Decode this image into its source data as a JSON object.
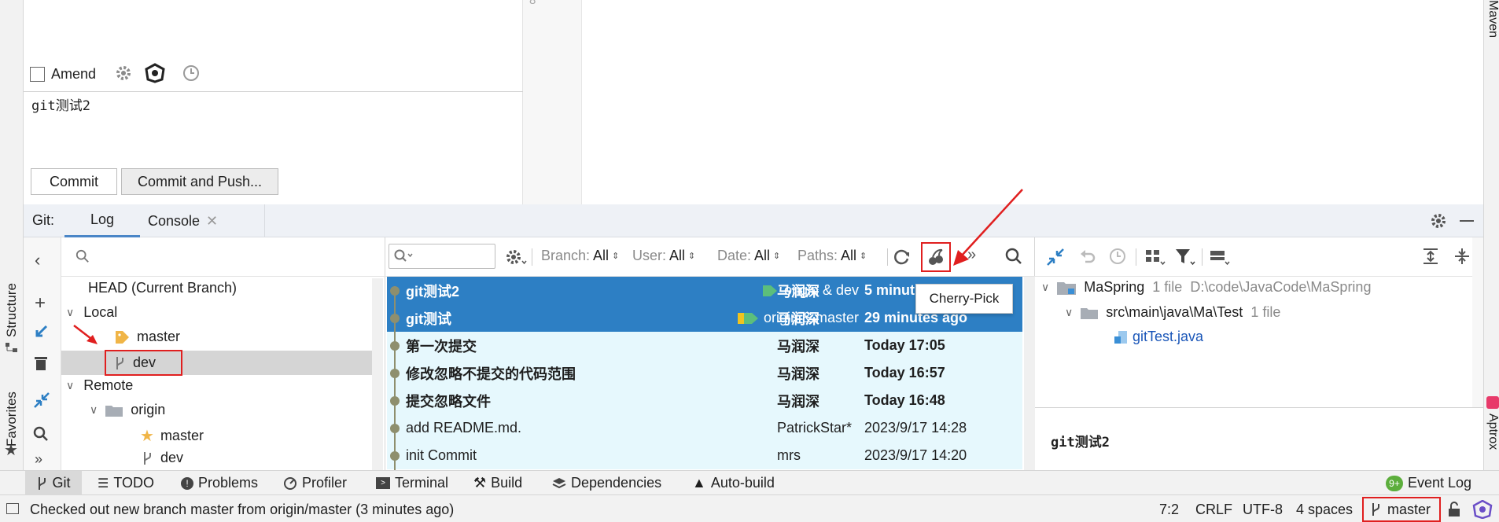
{
  "side_tools": {
    "structure": "Structure",
    "favorites": "Favorites",
    "maven": "Maven",
    "aptrox": "Aptrox"
  },
  "commit": {
    "amend_label": "Amend",
    "message": "git测试2",
    "commit_button": "Commit",
    "commit_push_button": "Commit and Push...",
    "gutter_line": "8"
  },
  "git_header": {
    "prefix": "Git:",
    "tab_log": "Log",
    "tab_console": "Console"
  },
  "branches": {
    "head": "HEAD (Current Branch)",
    "local": "Local",
    "local_master": "master",
    "local_dev": "dev",
    "remote": "Remote",
    "origin": "origin",
    "origin_master": "master",
    "origin_dev": "dev"
  },
  "log_toolbar": {
    "branch_label": "Branch:",
    "branch_value": "All",
    "user_label": "User:",
    "user_value": "All",
    "date_label": "Date:",
    "date_value": "All",
    "paths_label": "Paths:",
    "paths_value": "All",
    "tooltip": "Cherry-Pick"
  },
  "commits": [
    {
      "message": "git测试2",
      "refs": "origin & dev",
      "author": "马润深",
      "date": "5 minut"
    },
    {
      "message": "git测试",
      "refs": "origin & master",
      "author": "马润深",
      "date": "29 minutes ago"
    },
    {
      "message": "第一次提交",
      "refs": "",
      "author": "马润深",
      "date": "Today 17:05"
    },
    {
      "message": "修改忽略不提交的代码范围",
      "refs": "",
      "author": "马润深",
      "date": "Today 16:57"
    },
    {
      "message": "提交忽略文件",
      "refs": "",
      "author": "马润深",
      "date": "Today 16:48"
    },
    {
      "message": "add README.md.",
      "refs": "",
      "author": "PatrickStar*",
      "date": "2023/9/17 14:28"
    },
    {
      "message": "init Commit",
      "refs": "",
      "author": "mrs",
      "date": "2023/9/17 14:20"
    }
  ],
  "details": {
    "project": "MaSpring",
    "project_meta": "1 file",
    "project_path": "D:\\code\\JavaCode\\MaSpring",
    "folder": "src\\main\\java\\Ma\\Test",
    "folder_meta": "1 file",
    "file": "gitTest.java",
    "commit_message": "git测试2"
  },
  "bottom_tools": {
    "git": "Git",
    "todo": "TODO",
    "problems": "Problems",
    "profiler": "Profiler",
    "terminal": "Terminal",
    "build": "Build",
    "dependencies": "Dependencies",
    "autobuild": "Auto-build",
    "eventlog": "Event Log",
    "eventlog_badge": "9+"
  },
  "status": {
    "message": "Checked out new branch master from origin/master (3 minutes ago)",
    "position": "7:2",
    "line_sep": "CRLF",
    "encoding": "UTF-8",
    "indent": "4 spaces",
    "branch": "master"
  },
  "colors": {
    "selection": "#2d7fc4",
    "highlight_row": "#e6f8fd",
    "graph": "#8e8f6e",
    "annotation": "#e01f1f",
    "link": "#1a56b8"
  }
}
